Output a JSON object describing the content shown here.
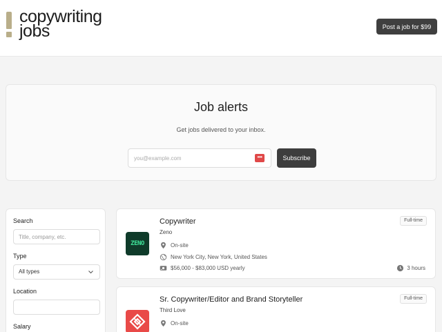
{
  "header": {
    "logo_line1": "copywriting",
    "logo_line2": "jobs",
    "post_job_label": "Post a job for $99"
  },
  "job_alerts": {
    "title": "Job alerts",
    "subtitle": "Get jobs delivered to your inbox.",
    "email_placeholder": "you@example.com",
    "password_icon_glyph": "•••",
    "subscribe_label": "Subscribe"
  },
  "filters": {
    "search_label": "Search",
    "search_placeholder": "Title, company, etc.",
    "type_label": "Type",
    "type_selected": "All types",
    "location_label": "Location",
    "location_value": "",
    "salary_label": "Salary"
  },
  "jobs": [
    {
      "title": "Copywriter",
      "company": "Zeno",
      "logo_text": "ZENO",
      "logo_bg": "#0f3b2a",
      "logo_fg": "#3fe39a",
      "workplace": "On-site",
      "location": "New York City, New York, United States",
      "salary": "$56,000 - $83,000 USD yearly",
      "type_badge": "Full-time",
      "posted": "3 hours"
    },
    {
      "title": "Sr. Copywriter/Editor and Brand Storyteller",
      "company": "Third Love",
      "logo_bg": "#e94a48",
      "workplace": "On-site",
      "type_badge": "Full-time"
    }
  ],
  "colors": {
    "accent_dark": "#3d3d3d",
    "logo_mark": "#b9ae8a",
    "password_icon": "#e04848"
  }
}
